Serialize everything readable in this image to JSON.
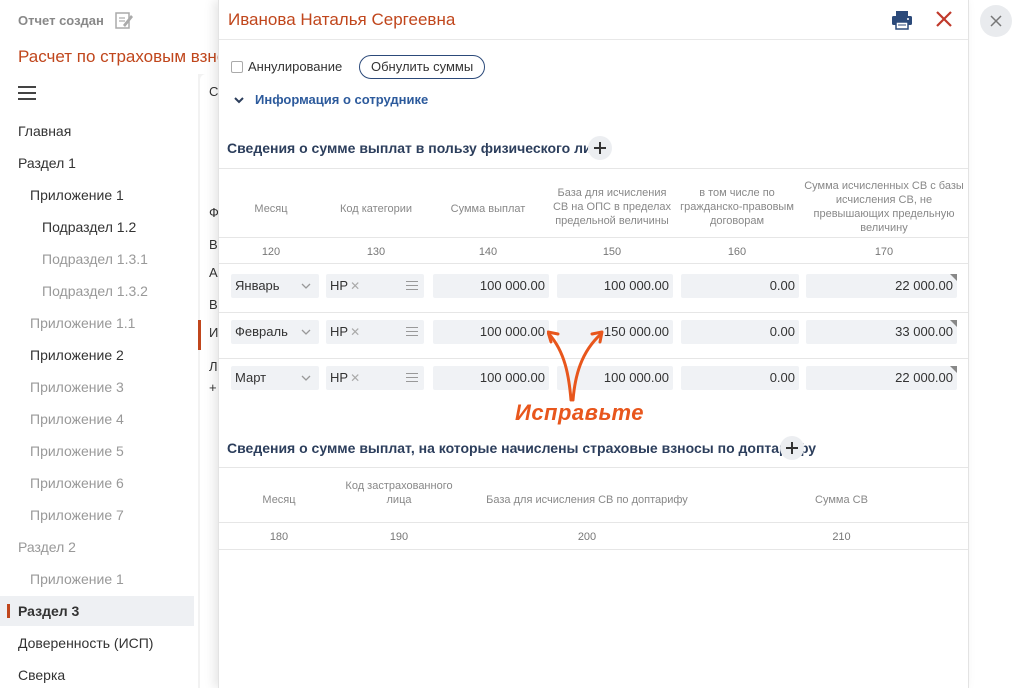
{
  "background": {
    "status": "Отчет создан",
    "title": "Расчет по страховым взносам",
    "nav": [
      {
        "label": "Главная",
        "muted": false
      },
      {
        "label": "Раздел 1",
        "muted": false
      },
      {
        "label": "Приложение 1",
        "muted": false
      },
      {
        "label": "Подраздел 1.2",
        "muted": false
      },
      {
        "label": "Подраздел 1.3.1",
        "muted": true
      },
      {
        "label": "Подраздел 1.3.2",
        "muted": true
      },
      {
        "label": "Приложение 1.1",
        "muted": true
      },
      {
        "label": "Приложение 2",
        "muted": false
      },
      {
        "label": "Приложение 3",
        "muted": true
      },
      {
        "label": "Приложение 4",
        "muted": true
      },
      {
        "label": "Приложение 5",
        "muted": true
      },
      {
        "label": "Приложение 6",
        "muted": true
      },
      {
        "label": "Приложение 7",
        "muted": true
      },
      {
        "label": "Раздел 2",
        "muted": true
      },
      {
        "label": "Приложение 1",
        "muted": true
      },
      {
        "label": "Раздел 3",
        "muted": false
      },
      {
        "label": "Доверенность (ИСП)",
        "muted": false
      },
      {
        "label": "Сверка",
        "muted": false
      }
    ],
    "card_chars": [
      "С",
      "Ф",
      "В",
      "А",
      "В",
      "И",
      "Л",
      "+"
    ]
  },
  "panel": {
    "title": "Иванова Наталья Сергеевна",
    "annul_label": "Аннулирование",
    "zero_button": "Обнулить суммы",
    "info_toggle": "Информация о сотруднике",
    "section1": {
      "title": "Сведения о сумме выплат в пользу физического лица",
      "headers": [
        "Месяц",
        "Код категории",
        "Сумма выплат",
        "База для исчисления СВ на ОПС в пределах предельной величины",
        "в том числе по гражданско-правовым договорам",
        "Сумма исчисленных СВ с базы исчисления СВ, не превышающих предельную величину"
      ],
      "colnums": [
        "120",
        "130",
        "140",
        "150",
        "160",
        "170"
      ],
      "rows": [
        {
          "month": "Январь",
          "code": "НР",
          "sum": "100 000.00",
          "base": "100 000.00",
          "gpd": "0.00",
          "contrib": "22 000.00"
        },
        {
          "month": "Февраль",
          "code": "НР",
          "sum": "100 000.00",
          "base": "150 000.00",
          "gpd": "0.00",
          "contrib": "33 000.00"
        },
        {
          "month": "Март",
          "code": "НР",
          "sum": "100 000.00",
          "base": "100 000.00",
          "gpd": "0.00",
          "contrib": "22 000.00"
        }
      ]
    },
    "annotation": "Исправьте",
    "section2": {
      "title": "Сведения о сумме выплат, на которые начислены страховые взносы по доптарифу",
      "headers": [
        "Месяц",
        "Код застрахованного лица",
        "База для исчисления СВ по доптарифу",
        "Сумма СВ"
      ],
      "colnums": [
        "180",
        "190",
        "200",
        "210"
      ]
    }
  },
  "colors": {
    "accent": "#c0461c",
    "link": "#2c5a9c",
    "annotation": "#e8561c"
  },
  "icons": [
    "edit-icon",
    "menu-icon",
    "print-icon",
    "close-icon",
    "chevron-down-icon",
    "plus-icon",
    "drag-handle-icon"
  ]
}
